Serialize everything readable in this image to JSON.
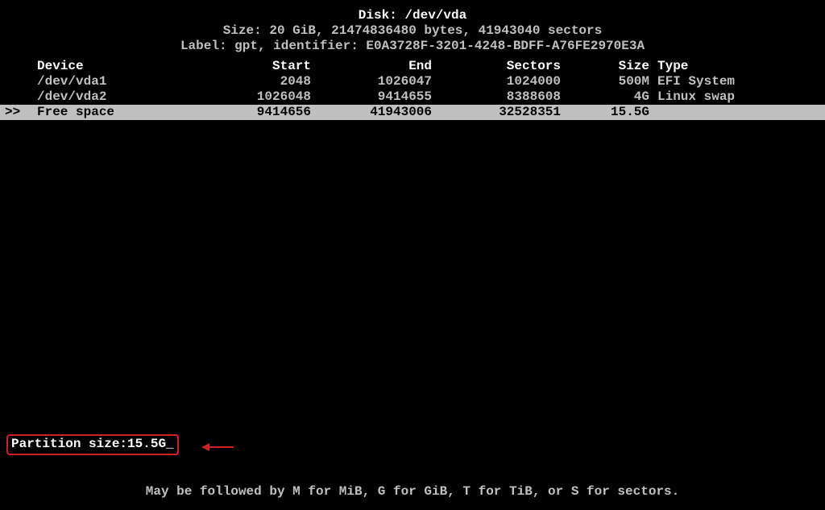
{
  "header": {
    "disk_line": "Disk: /dev/vda",
    "size_line": "Size: 20 GiB, 21474836480 bytes, 41943040 sectors",
    "label_line": "Label: gpt, identifier: E0A3728F-3201-4248-BDFF-A76FE2970E3A"
  },
  "table": {
    "columns": {
      "device": "Device",
      "start": "Start",
      "end": "End",
      "sectors": "Sectors",
      "size": "Size",
      "type": "Type"
    },
    "rows": [
      {
        "marker": "",
        "device": "/dev/vda1",
        "start": "2048",
        "end": "1026047",
        "sectors": "1024000",
        "size": "500M",
        "type": "EFI System",
        "selected": false
      },
      {
        "marker": "",
        "device": "/dev/vda2",
        "start": "1026048",
        "end": "9414655",
        "sectors": "8388608",
        "size": "4G",
        "type": "Linux swap",
        "selected": false
      },
      {
        "marker": ">>",
        "device": "Free space",
        "start": "9414656",
        "end": "41943006",
        "sectors": "32528351",
        "size": "15.5G",
        "type": "",
        "selected": true
      }
    ]
  },
  "prompt": {
    "label": "Partition size: ",
    "value": "15.5G",
    "cursor": "_"
  },
  "hint": "May be followed by M for MiB, G for GiB, T for TiB, or S for sectors."
}
